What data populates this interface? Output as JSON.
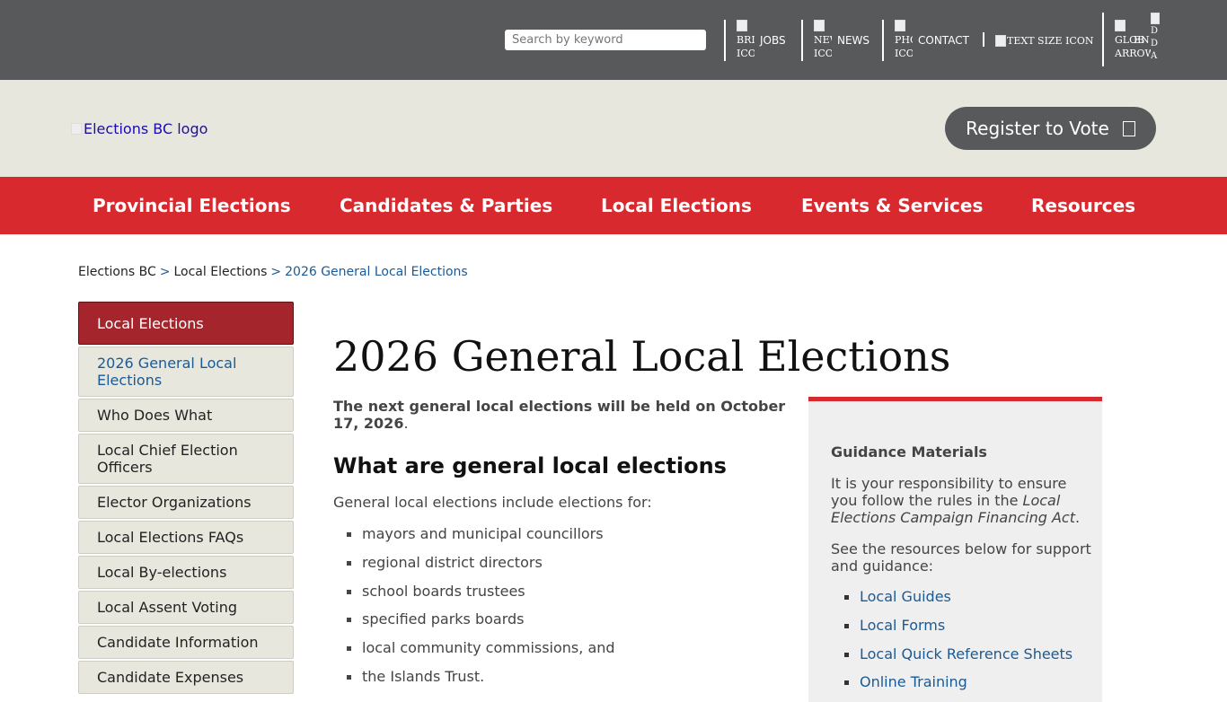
{
  "topbar": {
    "search_placeholder": "Search by keyword",
    "links": [
      {
        "icon_alt": "BRI ICO",
        "label": "JOBS"
      },
      {
        "icon_alt": "NEW ICO",
        "label": "NEWS"
      },
      {
        "icon_alt": "PHO ICO",
        "label": "CONTACT"
      }
    ],
    "text_size_alt": "TEXT SIZE ICON",
    "globe_alt": "GLOB ARROW",
    "lang_alt": "EN",
    "extra_alt": "D D A"
  },
  "banner": {
    "logo_alt": "Elections BC logo",
    "register_label": "Register to Vote"
  },
  "mainnav": {
    "items": [
      "Provincial Elections",
      "Candidates & Parties",
      "Local Elections",
      "Events & Services",
      "Resources"
    ]
  },
  "breadcrumb": {
    "items": [
      "Elections BC",
      "Local Elections",
      "2026 General Local Elections"
    ],
    "separator": ">"
  },
  "sidebar": {
    "heading": "Local Elections",
    "items": [
      "2026 General Local Elections",
      "Who Does What",
      "Local Chief Election Officers",
      "Elector Organizations",
      "Local Elections FAQs",
      "Local By-elections",
      "Local Assent Voting",
      "Candidate Information",
      "Candidate Expenses"
    ]
  },
  "content": {
    "title": "2026 General Local Elections",
    "lead": "The next general local elections will be held on October 17, 2026",
    "lead_end": ".",
    "subheading": "What are general local elections",
    "intro": "General local elections include elections for:",
    "bullets": [
      "mayors and municipal councillors",
      "regional district directors",
      "school boards trustees",
      "specified parks boards",
      "local community commissions, and",
      "the Islands Trust."
    ]
  },
  "panel": {
    "title": "Guidance Materials",
    "p1_start": "It is your responsibility to ensure you follow the rules in the ",
    "p1_italic": "Local Elections Campaign Financing Act",
    "p1_end": ".",
    "p2": "See the resources below for support and guidance:",
    "links": [
      "Local Guides",
      "Local Forms",
      "Local Quick Reference Sheets",
      "Online Training"
    ]
  },
  "colors": {
    "topbar": "#58595b",
    "banner": "#e8e7dd",
    "nav": "#d8292f",
    "sidebar_active": "#a4262c",
    "link": "#1a5a96"
  }
}
